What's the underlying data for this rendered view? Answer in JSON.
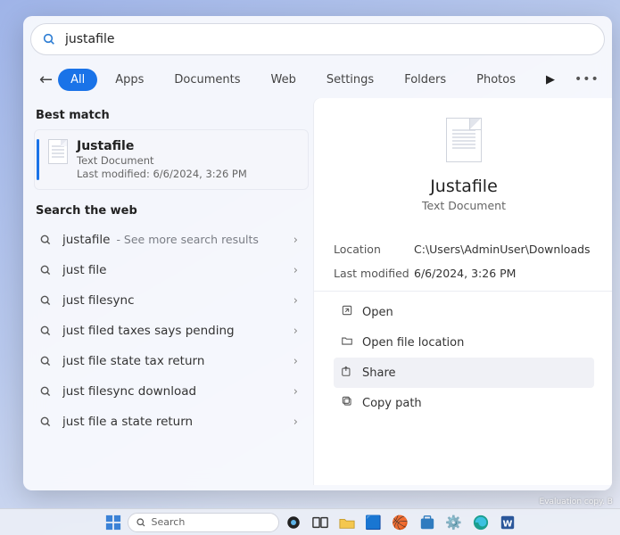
{
  "search": {
    "value": "justafile"
  },
  "tabs": {
    "back": "←",
    "items": [
      "All",
      "Apps",
      "Documents",
      "Web",
      "Settings",
      "Folders",
      "Photos"
    ]
  },
  "left": {
    "best_header": "Best match",
    "best": {
      "title": "Justafile",
      "type": "Text Document",
      "modified": "Last modified: 6/6/2024, 3:26 PM"
    },
    "web_header": "Search the web",
    "web_items": [
      {
        "text": "justafile",
        "extra": " - See more search results"
      },
      {
        "text": "just file",
        "extra": ""
      },
      {
        "text": "just filesync",
        "extra": ""
      },
      {
        "text": "just filed taxes says pending",
        "extra": ""
      },
      {
        "text": "just file state tax return",
        "extra": ""
      },
      {
        "text": "just filesync download",
        "extra": ""
      },
      {
        "text": "just file a state return",
        "extra": ""
      }
    ]
  },
  "right": {
    "title": "Justafile",
    "subtitle": "Text Document",
    "meta": {
      "location_label": "Location",
      "location_value": "C:\\Users\\AdminUser\\Downloads",
      "modified_label": "Last modified",
      "modified_value": "6/6/2024, 3:26 PM"
    },
    "actions": {
      "open": "Open",
      "open_location": "Open file location",
      "share": "Share",
      "copy_path": "Copy path"
    }
  },
  "taskbar": {
    "search_placeholder": "Search",
    "eval_text": "Evaluation copy. B"
  }
}
